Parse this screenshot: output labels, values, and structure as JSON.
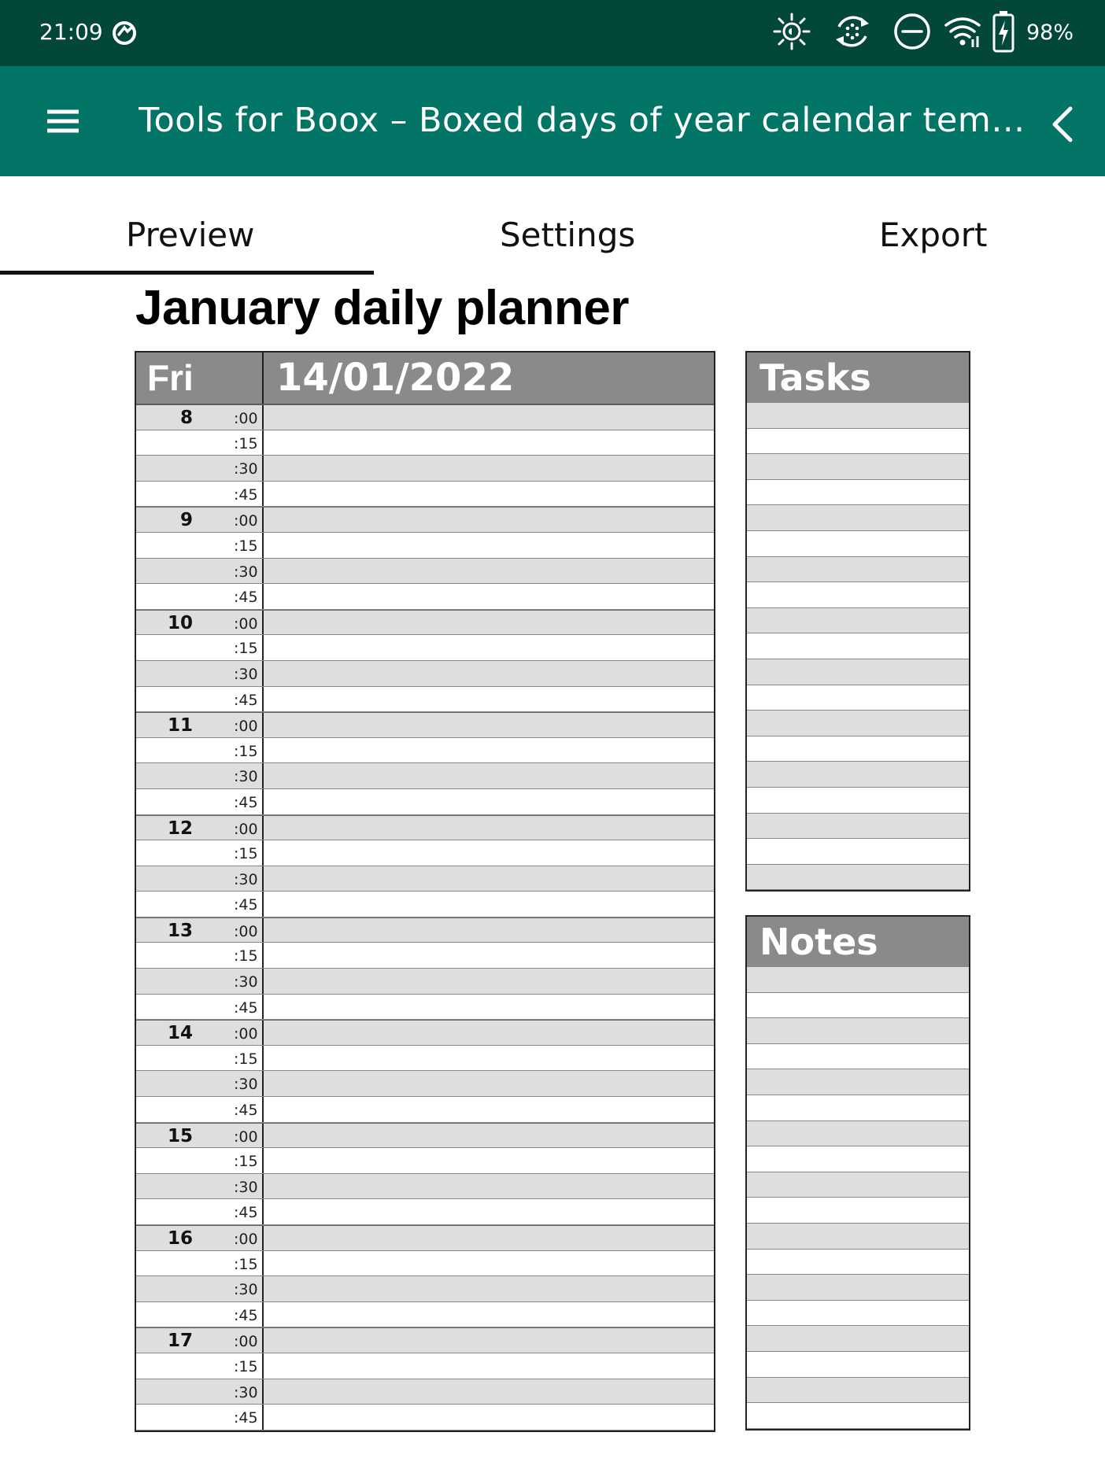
{
  "status_bar": {
    "time": "21:09",
    "battery_percent": "98%",
    "icons": [
      "sync-icon",
      "brightness-icon",
      "refresh-icon",
      "do-not-disturb-icon",
      "wifi-icon",
      "battery-charging-icon"
    ]
  },
  "app_bar": {
    "menu_icon": "hamburger-menu-icon",
    "title": "Tools for Boox – Boxed days of year calendar templa…",
    "back_icon": "chevron-left-icon"
  },
  "tabs": [
    {
      "label": "Preview",
      "active": true
    },
    {
      "label": "Settings",
      "active": false
    },
    {
      "label": "Export",
      "active": false
    }
  ],
  "planner": {
    "title": "January daily planner",
    "day_of_week": "Fri",
    "date": "14/01/2022",
    "hours": [
      "8",
      "9",
      "10",
      "11",
      "12",
      "13",
      "14",
      "15",
      "16",
      "17"
    ],
    "minutes": [
      ":00",
      ":15",
      ":30",
      ":45"
    ],
    "tasks_title": "Tasks",
    "notes_title": "Notes"
  },
  "colors": {
    "status_bar": "#03463a",
    "app_bar": "#037566",
    "header_gray": "#8a8a8a",
    "row_shade": "#dedede"
  }
}
